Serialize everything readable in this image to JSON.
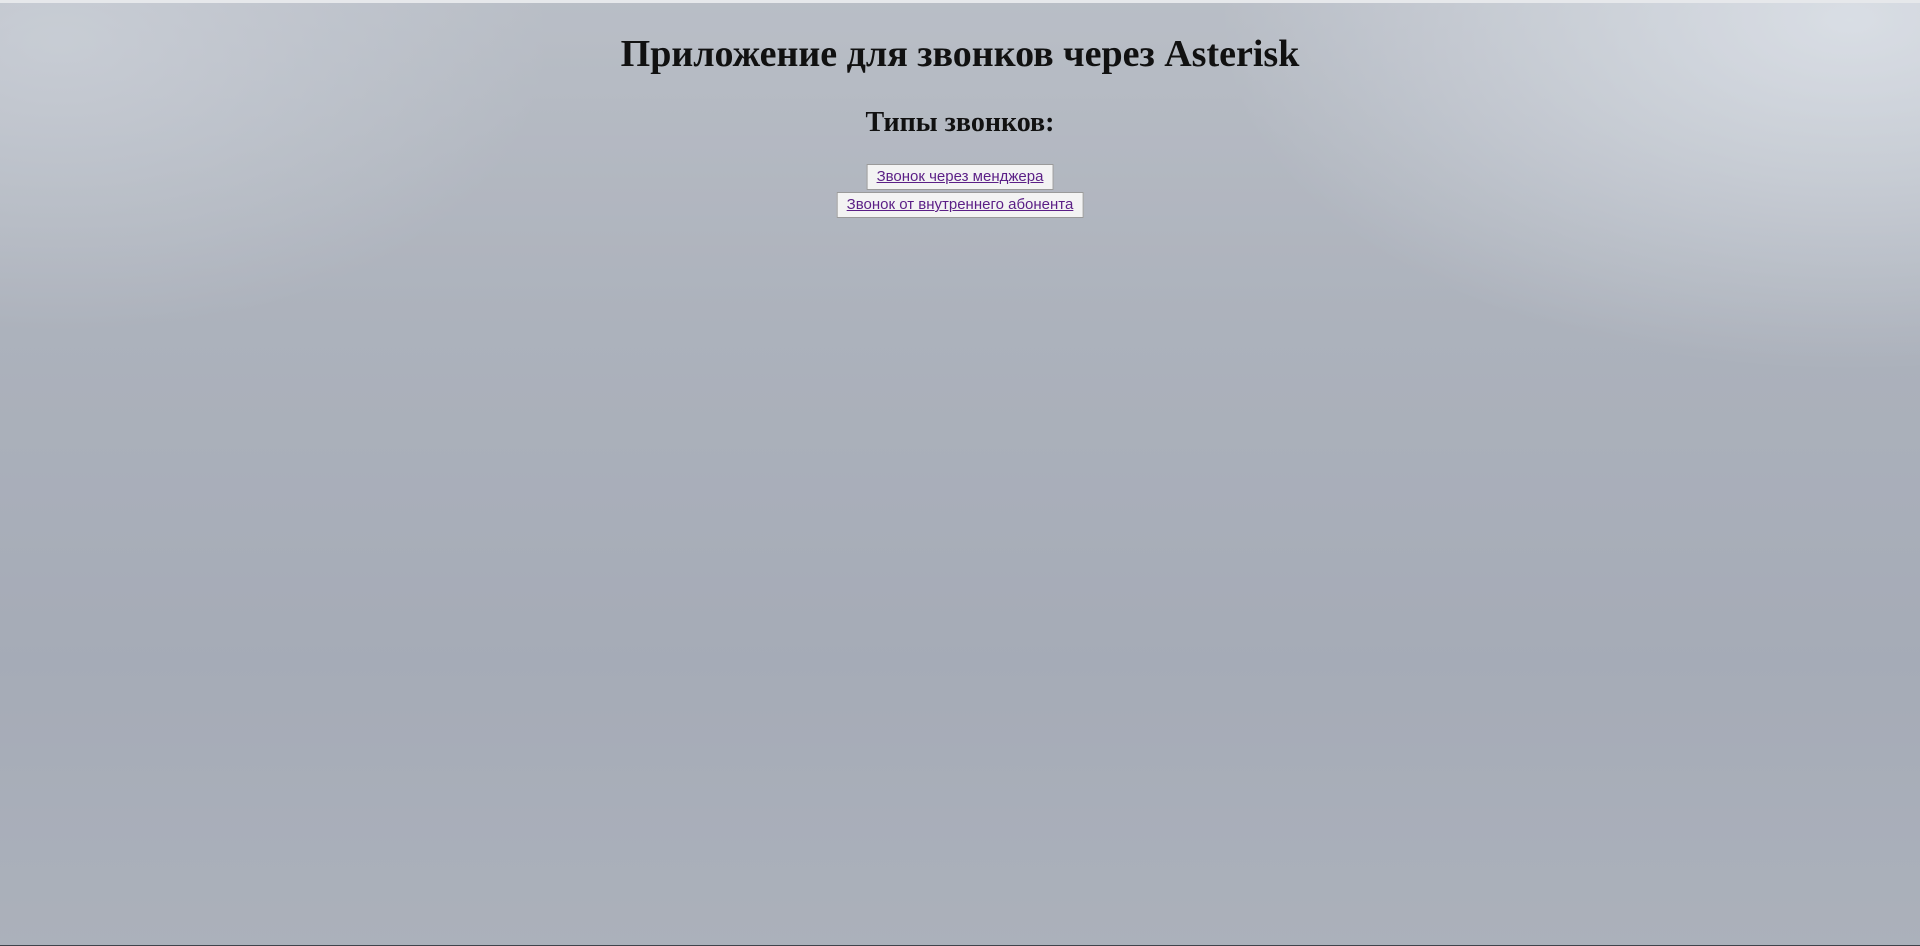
{
  "page": {
    "title": "Приложение для звонков через Asterisk",
    "section_title": "Типы звонков:"
  },
  "call_types": [
    {
      "label": "Звонок через менджера"
    },
    {
      "label": "Звонок от внутреннего абонента"
    }
  ],
  "colors": {
    "link": "#5b1f86",
    "link_background": "#f3f3f3",
    "background": "#a2a8b3"
  }
}
